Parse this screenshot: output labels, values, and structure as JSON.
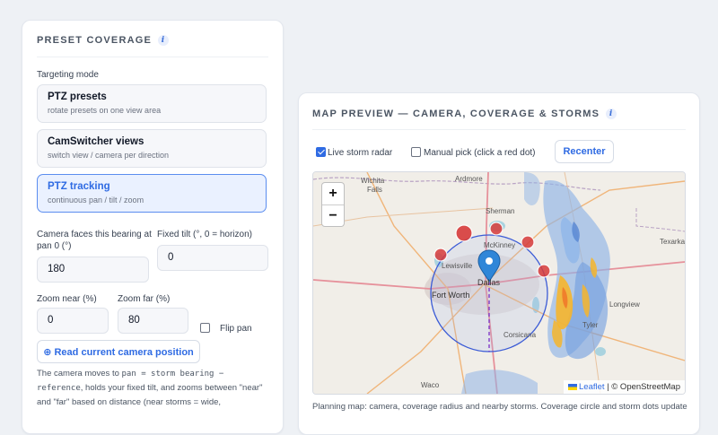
{
  "preset": {
    "title": "PRESET COVERAGE",
    "targeting_label": "Targeting mode",
    "modes": [
      {
        "title": "PTZ presets",
        "subtitle": "rotate presets on one view area",
        "active": false
      },
      {
        "title": "CamSwitcher views",
        "subtitle": "switch view / camera per direction",
        "active": false
      },
      {
        "title": "PTZ tracking",
        "subtitle": "continuous pan / tilt / zoom",
        "active": true
      }
    ],
    "bearing_label": "Camera faces this bearing at pan 0 (°)",
    "bearing_value": "180",
    "tilt_label": "Fixed tilt (°, 0 = horizon)",
    "tilt_value": "0",
    "zoom_near_label": "Zoom near (%)",
    "zoom_near_value": "0",
    "zoom_far_label": "Zoom far (%)",
    "zoom_far_value": "80",
    "flip_pan_label": "Flip pan",
    "flip_pan_checked": false,
    "read_button_label": "⊕ Read current camera position",
    "help_1": "The camera moves to ",
    "help_code_1": "pan = storm bearing − reference",
    "help_2": ", holds your fixed tilt, and zooms between \"near\" and \"far\" based on distance (near storms = wide,"
  },
  "map_preview": {
    "title": "MAP PREVIEW — CAMERA, COVERAGE & STORMS",
    "live_radar_label": "Live storm radar",
    "live_radar_checked": true,
    "manual_pick_label": "Manual pick (click a red dot)",
    "manual_pick_checked": false,
    "recenter_label": "Recenter",
    "zoom_in": "+",
    "zoom_out": "−",
    "attribution_link": "Leaflet",
    "attribution_text": "| © OpenStreetMap",
    "cities": {
      "wichita_falls_1": "Wichita",
      "wichita_falls_2": "Falls",
      "ardmore": "Ardmore",
      "sherman": "Sherman",
      "mckinney": "McKinney",
      "lewisville": "Lewisville",
      "dallas": "Dallas",
      "fort_worth": "Fort Worth",
      "corsicana": "Corsicana",
      "texarkana": "Texarka",
      "longview": "Longview",
      "tyler": "Tyler",
      "waco": "Waco"
    },
    "colors": {
      "accent": "#2f6be3",
      "storm": "#d73b3b",
      "radar_light": "#8fb4e6",
      "radar_heavy": "#f6b52c",
      "coverage": "#3b5bd6"
    }
  },
  "bottom_text": "Planning map: camera, coverage radius and nearby storms. Coverage circle and storm dots update live ·"
}
